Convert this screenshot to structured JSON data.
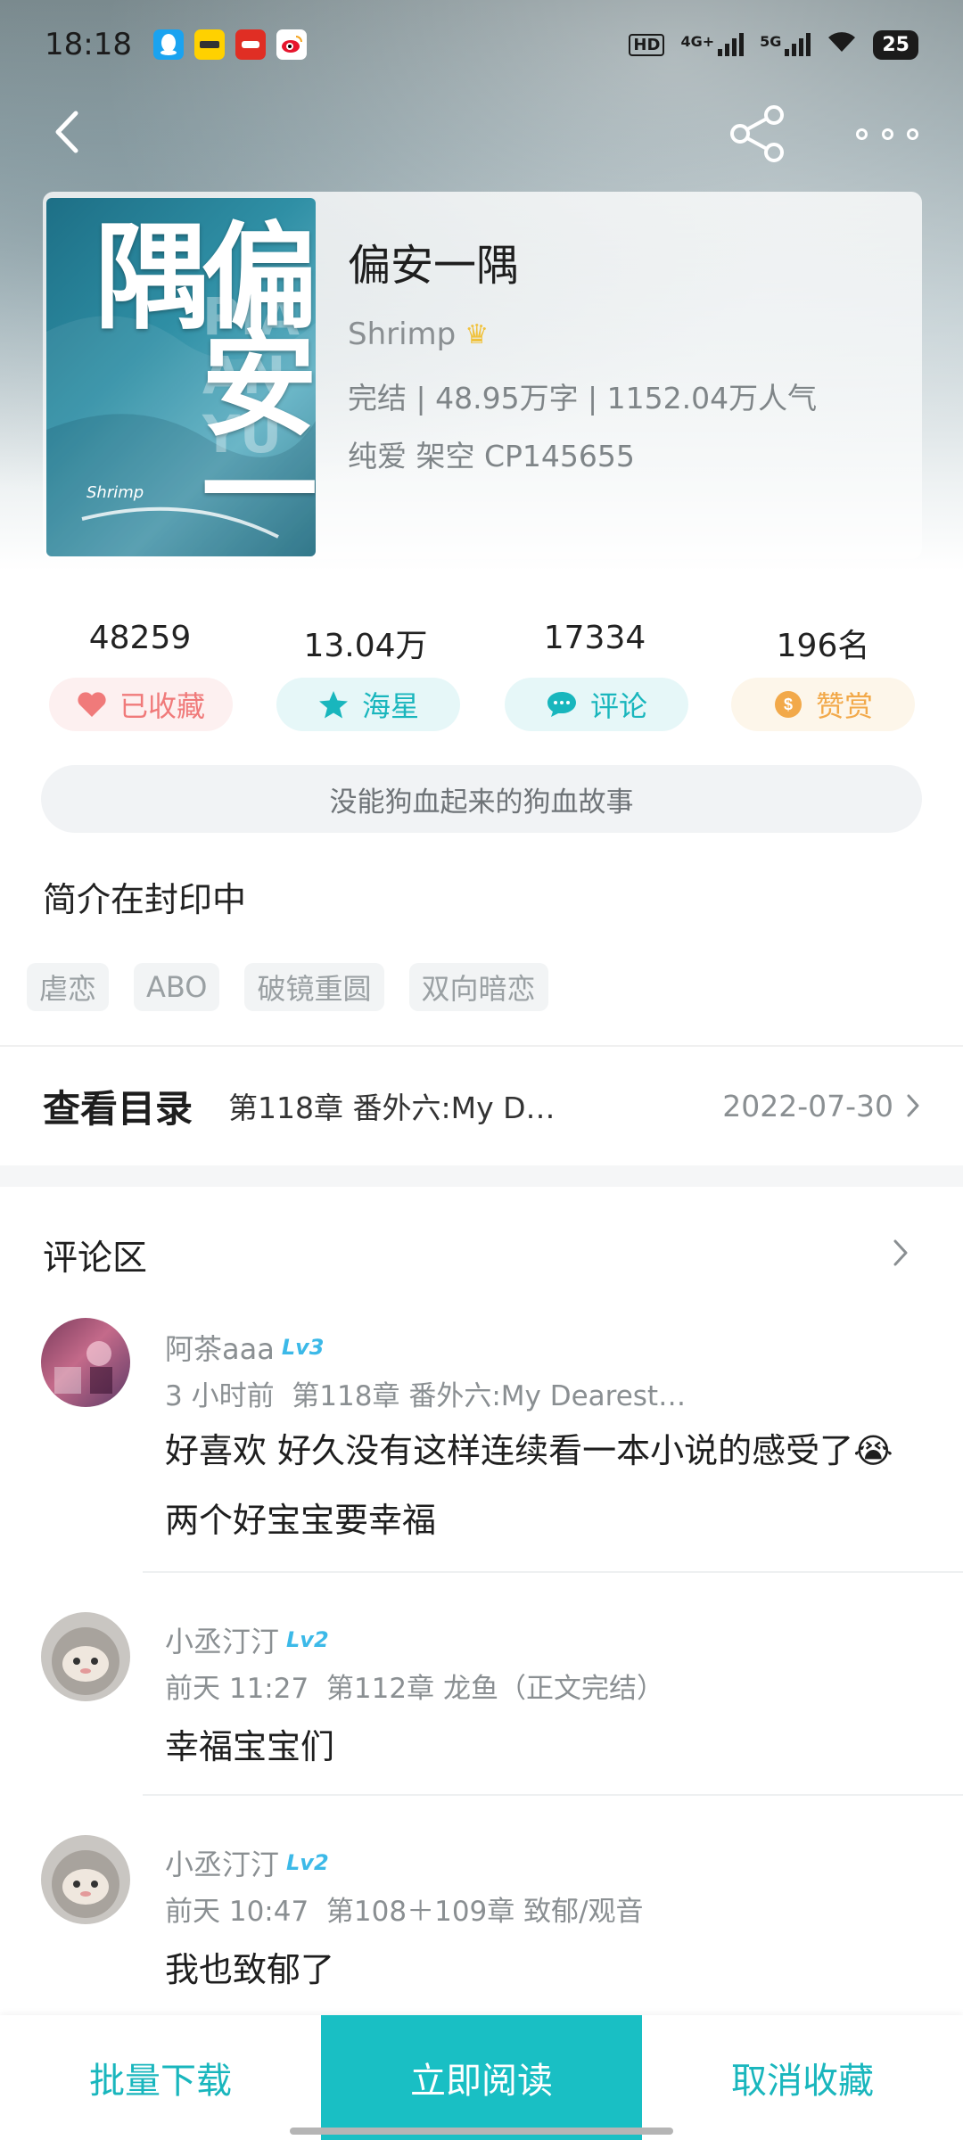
{
  "status_bar": {
    "time": "18:18",
    "app_icons": [
      "qq-icon",
      "meituan-icon",
      "pinduoduo-icon",
      "weibo-icon"
    ],
    "network_1": "4G+",
    "network_2": "5G",
    "battery": "25"
  },
  "book": {
    "cover_title": "偏安一隅",
    "cover_english": "PIA AN YU",
    "cover_author": "Shrimp",
    "title": "偏安一隅",
    "author": "Shrimp",
    "meta": "完结 | 48.95万字 | 1152.04万人气",
    "tags_line": "纯爱  架空  CP145655"
  },
  "stats": [
    {
      "value": "48259",
      "label": "已收藏",
      "icon": "heart-icon",
      "color": "#f07a7a"
    },
    {
      "value": "13.04万",
      "label": "海星",
      "icon": "star-icon",
      "color": "#19b6bd"
    },
    {
      "value": "17334",
      "label": "评论",
      "icon": "comment-bubble-icon",
      "color": "#19b6bd"
    },
    {
      "value": "196名",
      "label": "赞赏",
      "icon": "coin-icon",
      "color": "#f2a94a"
    }
  ],
  "slogan": "没能狗血起来的狗血故事",
  "intro": "简介在封印中",
  "tags": [
    "虐恋",
    "ABO",
    "破镜重圆",
    "双向暗恋"
  ],
  "toc": {
    "label": "查看目录",
    "latest_chapter": "第118章 番外六:My D…",
    "date": "2022-07-30"
  },
  "comments_section": {
    "title": "评论区",
    "items": [
      {
        "user": "阿茶aaa",
        "level": "Lv3",
        "time": "3 小时前",
        "chapter": "第118章 番外六:My Dearest…",
        "text": "好喜欢 好久没有这样连续看一本小说的感受了😭两个好宝宝要幸福"
      },
      {
        "user": "小丞汀汀",
        "level": "Lv2",
        "time": "前天 11:27",
        "chapter": "第112章 龙鱼（正文完结）",
        "text": "幸福宝宝们"
      },
      {
        "user": "小丞汀汀",
        "level": "Lv2",
        "time": "前天 10:47",
        "chapter": "第108＋109章 致郁/观音",
        "text": "我也致郁了"
      }
    ]
  },
  "bottom_bar": {
    "download": "批量下载",
    "read": "立即阅读",
    "unfavorite": "取消收藏"
  },
  "colors": {
    "accent": "#19bfc4",
    "favorite": "#f07a7a",
    "tip": "#f2a94a",
    "level_badge": "#3cb9e8"
  }
}
